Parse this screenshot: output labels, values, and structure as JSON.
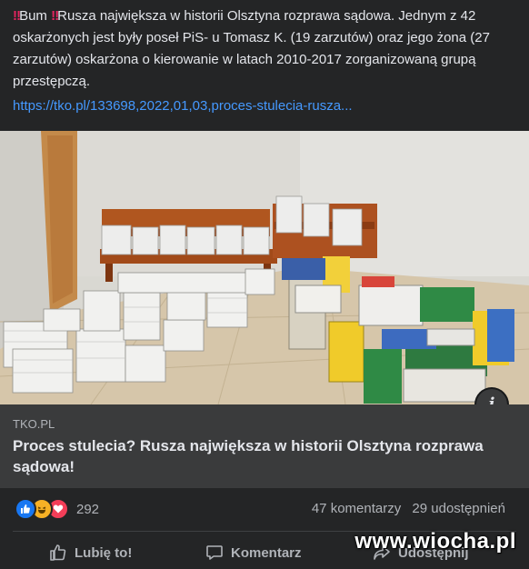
{
  "post": {
    "bang_icon": "double-exclamation-icon",
    "text_a": "Bum ",
    "text_b": "Rusza największa w historii Olsztyna rozprawa sądowa. Jednym z 42 oskarżonych jest były poseł PiS- u Tomasz K. (19 zarzutów) oraz jego żona (27 zarzutów) oskarżona o kierowanie w latach 2010-2017 zorganizowaną grupą przestępczą.",
    "link": "https://tko.pl/133698,2022,01,03,proces-stulecia-rusza..."
  },
  "card": {
    "domain": "TKO.PL",
    "title": "Proces stulecia? Rusza największa w historii Olsztyna rozprawa sądowa!",
    "info_glyph": "i"
  },
  "engagement": {
    "reactions": [
      "like-icon",
      "haha-icon",
      "love-icon"
    ],
    "reaction_count": "292",
    "comments": "47 komentarzy",
    "shares": "29 udostępnień"
  },
  "actions": {
    "like": "Lubię to!",
    "comment": "Komentarz",
    "share": "Udostępnij"
  },
  "watermark": "www.wiocha.pl",
  "colors": {
    "background": "#242526",
    "card": "#3a3b3c",
    "link": "#4599ff",
    "text": "#e4e6eb",
    "muted": "#b0b3b8"
  }
}
